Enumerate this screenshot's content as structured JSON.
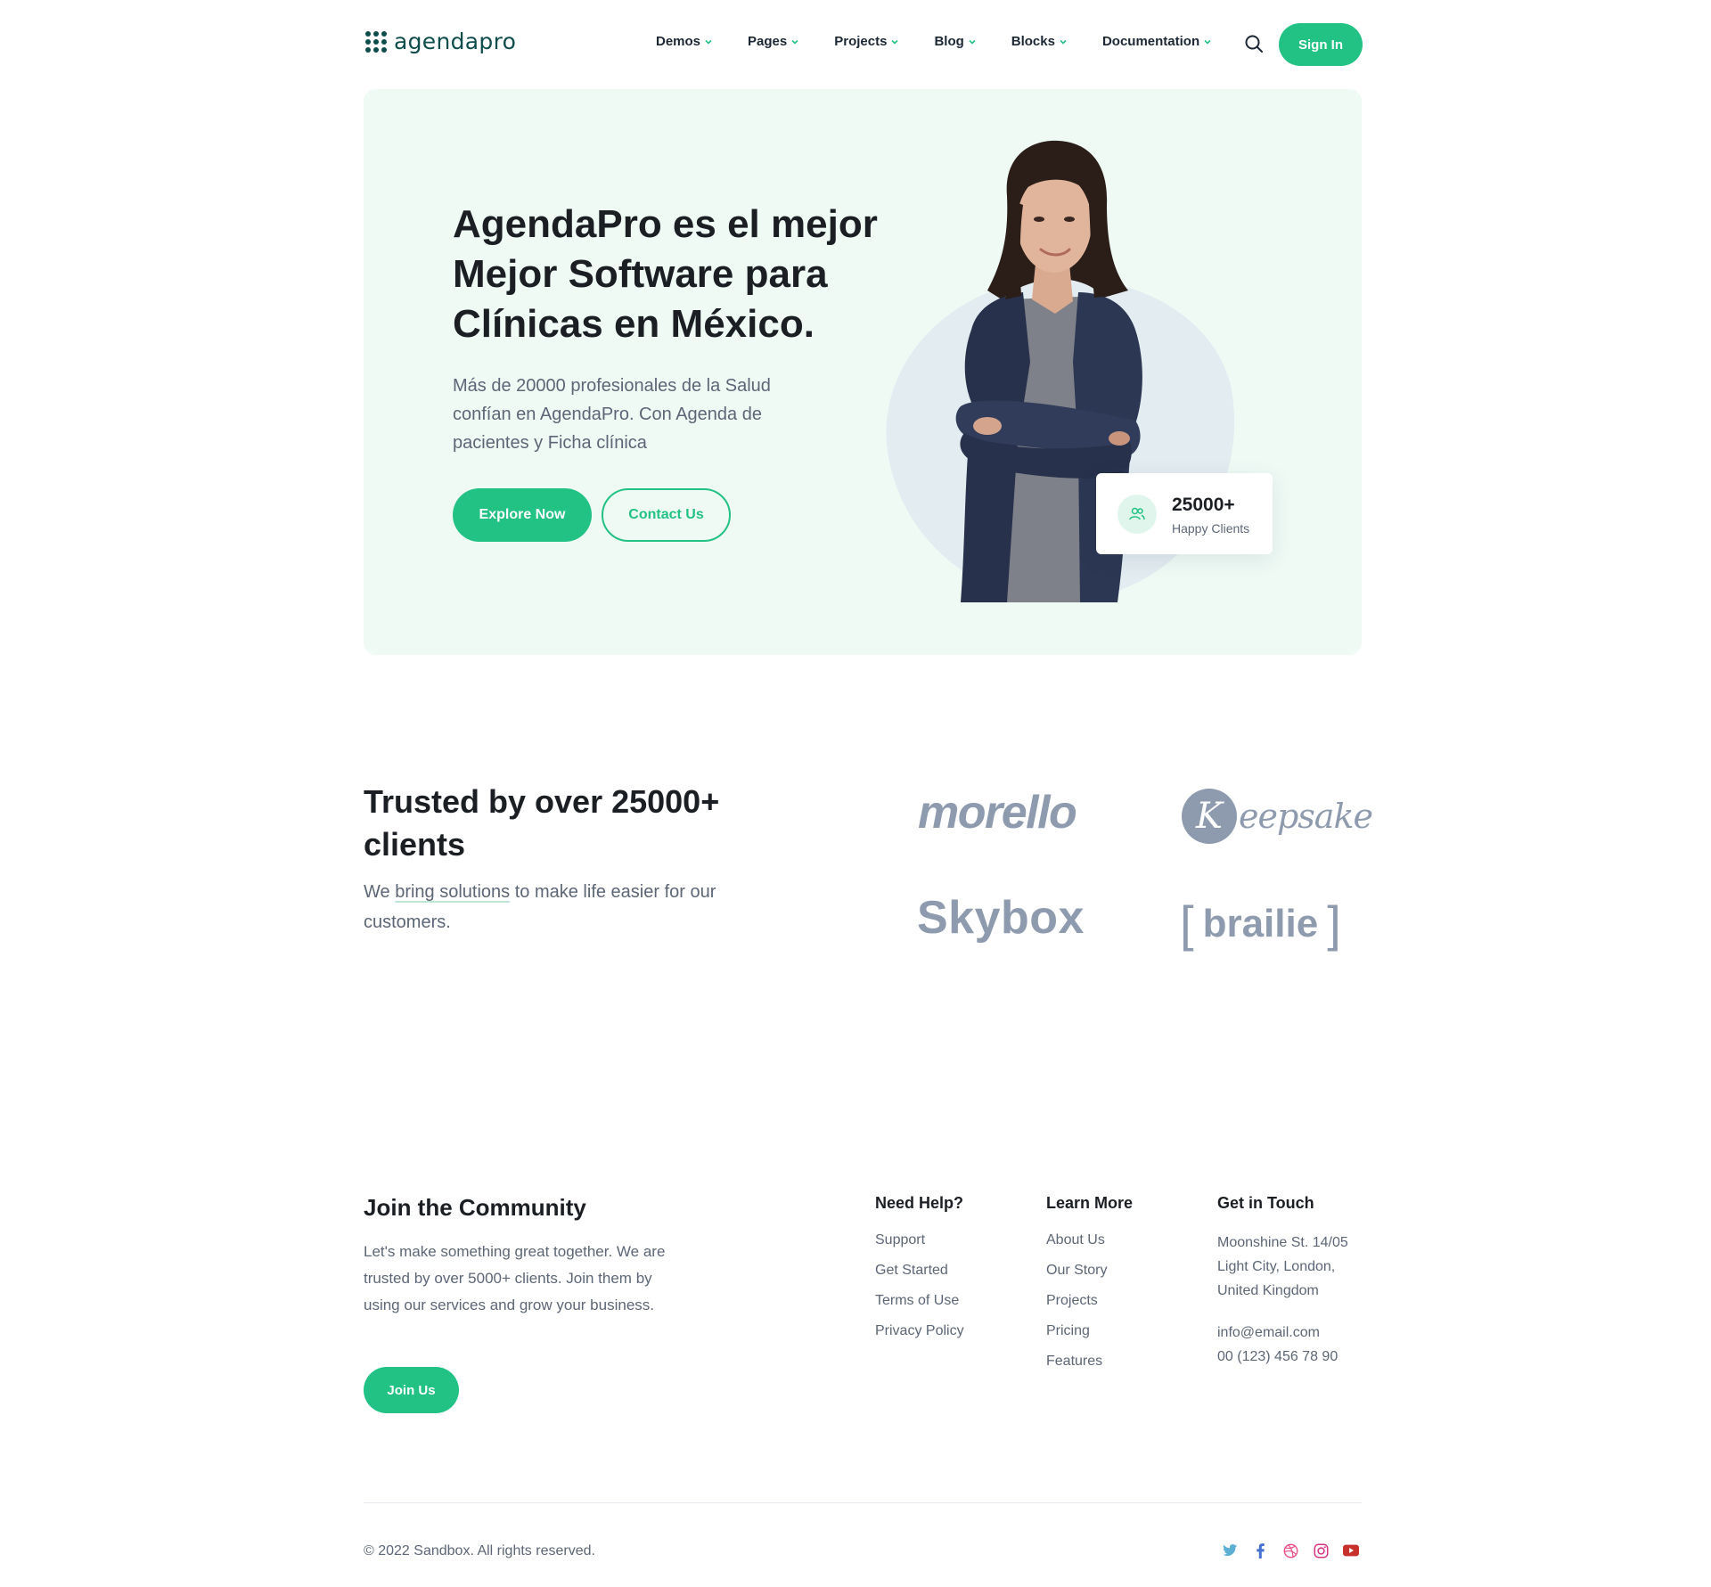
{
  "header": {
    "logo_text": "agendapro",
    "nav": [
      {
        "label": "Demos"
      },
      {
        "label": "Pages"
      },
      {
        "label": "Projects"
      },
      {
        "label": "Blog"
      },
      {
        "label": "Blocks"
      },
      {
        "label": "Documentation"
      }
    ],
    "signin_label": "Sign In"
  },
  "hero": {
    "title": "AgendaPro es el mejor Mejor Software para Clínicas en México.",
    "subtitle": "Más de 20000 profesionales de la Salud confían en AgendaPro. Con Agenda de pacientes y Ficha clínica",
    "primary_button": "Explore Now",
    "secondary_button": "Contact Us",
    "stat": {
      "value": "25000+",
      "label": "Happy Clients"
    }
  },
  "trusted": {
    "title": "Trusted by over 25000+ clients",
    "subtitle_pre": "We ",
    "subtitle_link": "bring solutions",
    "subtitle_post": " to make life easier for our customers.",
    "clients": {
      "morello": "morello",
      "keepsake_initial": "K",
      "keepsake_rest": "eepsake",
      "skybox": "Skybox",
      "brailie": "brailie"
    }
  },
  "footer": {
    "join_title": "Join the Community",
    "join_text": "Let's make something great together. We are trusted by over 5000+ clients. Join them by using our services and grow your business.",
    "join_button": "Join Us",
    "help": {
      "title": "Need Help?",
      "links": [
        "Support",
        "Get Started",
        "Terms of Use",
        "Privacy Policy"
      ]
    },
    "learn": {
      "title": "Learn More",
      "links": [
        "About Us",
        "Our Story",
        "Projects",
        "Pricing",
        "Features"
      ]
    },
    "touch": {
      "title": "Get in Touch",
      "address": [
        "Moonshine St. 14/05",
        "Light City, London,",
        "United Kingdom"
      ],
      "email": "info@email.com",
      "phone": "00 (123) 456 78 90"
    },
    "copyright": "© 2022 Sandbox. All rights reserved.",
    "socials": [
      "twitter-icon",
      "facebook-icon",
      "dribbble-icon",
      "instagram-icon",
      "youtube-icon"
    ]
  },
  "colors": {
    "accent": "#22c184",
    "hero_bg": "#effaf5",
    "logo": "#0f4c4c",
    "twitter": "#5daed5",
    "facebook": "#4470cf",
    "dribbble": "#e94d88",
    "instagram": "#d53581",
    "youtube": "#c8312b"
  }
}
